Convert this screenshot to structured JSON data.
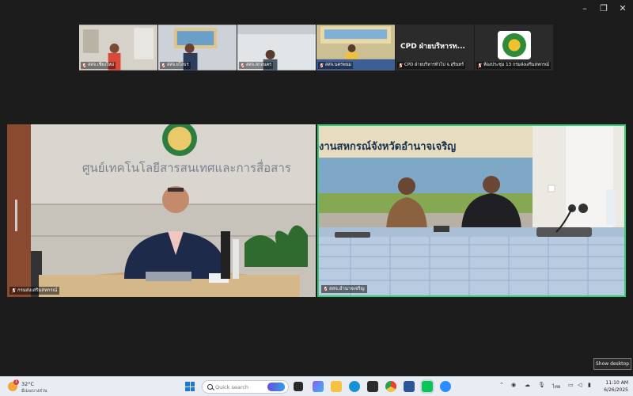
{
  "window": {
    "controls": {
      "minimize": "–",
      "maximize": "❐",
      "close": "✕"
    }
  },
  "thumbnails": [
    {
      "label": "สสจ.เชียงใหม่",
      "kind": "video",
      "bg": "#d8d4cc"
    },
    {
      "label": "สสจ.ยโสธร",
      "kind": "video",
      "bg": "#c9cfd8"
    },
    {
      "label": "สสจ.สกลนคร",
      "kind": "video",
      "bg": "#dfe3e6"
    },
    {
      "label": "สสจ.นครพนม",
      "kind": "video",
      "bg": "#c8b98c"
    },
    {
      "label": "CPD ฝ่ายบริหารทั่วไป จ.สุรินทร์",
      "kind": "text",
      "title": "CPD ฝ่ายบริหารท...",
      "bg": "#2b2b2b"
    },
    {
      "label": "ห้องประชุม 13 กรมส่งเสริมสหกรณ์",
      "kind": "logo",
      "bg": "#2b2b2b"
    }
  ],
  "main_tiles": [
    {
      "label": "กรมส่งเสริมสหกรณ์",
      "wall_text": "ศูนย์เทคโนโลยีสารสนเทศและการสื่อสาร",
      "active": false
    },
    {
      "label": "สสจ.อำนาจเจริญ",
      "banner_text": "งานสหกรณ์จังหวัดอำนาจเจริญ",
      "active": true
    }
  ],
  "taskbar": {
    "weather": {
      "temp": "32°C",
      "condition": "มีเมฆบางส่วน",
      "badge": "1"
    },
    "search_placeholder": "Quick search",
    "tray_lang": "ไทย",
    "time": "11:10 AM",
    "date": "6/26/2025"
  },
  "tooltip": "Show desktop",
  "colors": {
    "active_speaker": "#2fd07a",
    "background": "#1c1c1c",
    "taskbar": "#e9edf3"
  }
}
